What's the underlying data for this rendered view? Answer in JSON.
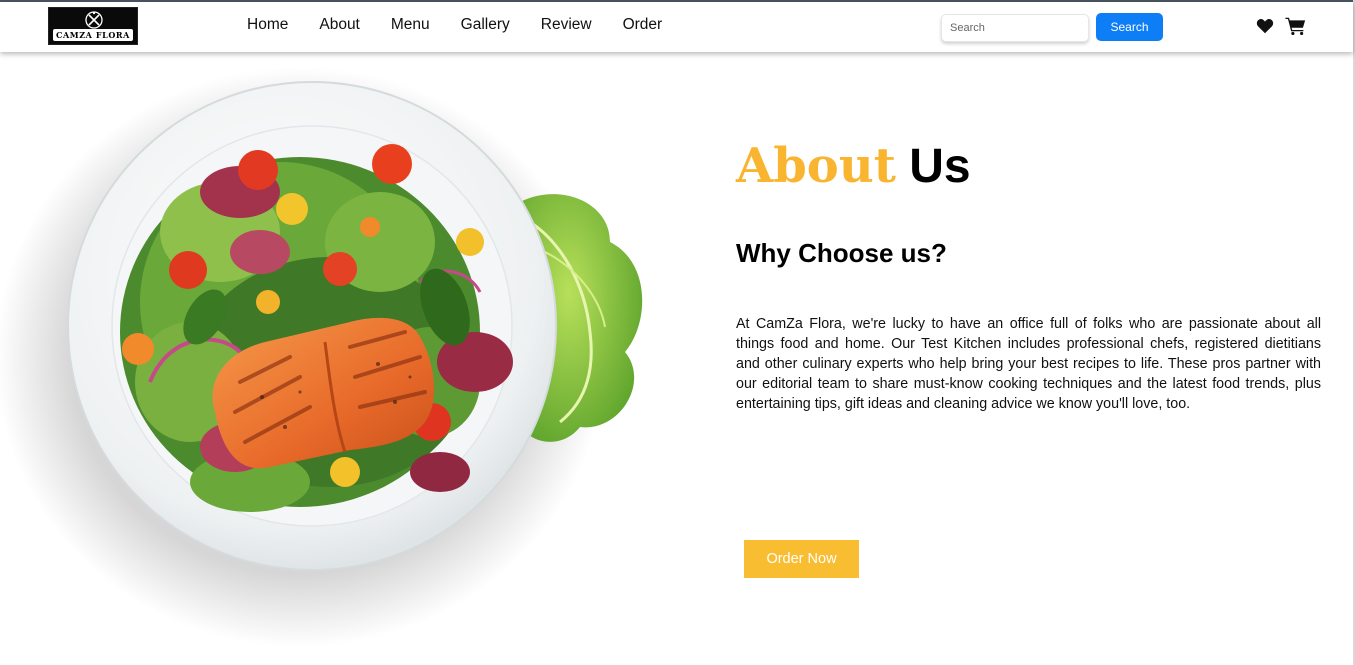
{
  "brand": {
    "logo_text": "CAMZA FLORA"
  },
  "nav": {
    "links": [
      {
        "label": "Home"
      },
      {
        "label": "About"
      },
      {
        "label": "Menu"
      },
      {
        "label": "Gallery"
      },
      {
        "label": "Review"
      },
      {
        "label": "Order"
      }
    ]
  },
  "search": {
    "placeholder": "Search",
    "value": "",
    "button_label": "Search"
  },
  "icons": {
    "wishlist": "heart-icon",
    "cart": "cart-icon"
  },
  "hero_image": {
    "subject": "salmon-salad-plate"
  },
  "about": {
    "title_highlight": "About",
    "title_rest": "Us",
    "subtitle": "Why Choose us?",
    "paragraph": "At CamZa Flora, we're lucky to have an office full of folks who are passionate about all things food and home. Our Test Kitchen includes professional chefs, registered dietitians and other culinary experts who help bring your best recipes to life. These pros partner with our editorial team to share must-know cooking techniques and the latest food trends, plus entertaining tips, gift ideas and cleaning advice we know you'll love, too.",
    "cta_label": "Order Now"
  },
  "colors": {
    "accent": "#f9b52f",
    "button_accent": "#f9bd31",
    "search_button": "#0d7ef5",
    "text": "#000000"
  }
}
